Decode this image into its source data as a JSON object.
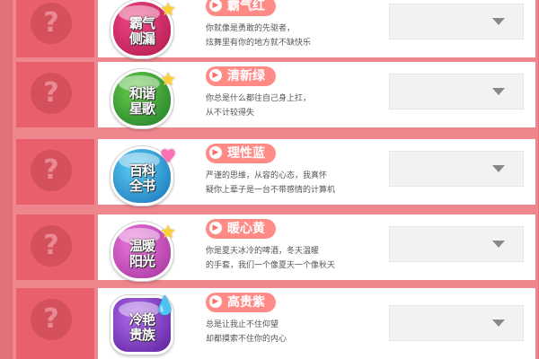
{
  "rows": [
    {
      "badge_text": [
        "霸气",
        "侧漏"
      ],
      "badge_color": "#c8265a",
      "badge_icon": "heart-star-icon",
      "title": "霸气红",
      "desc": [
        "你就像是勇敢的先驱者，",
        "炫舞里有你的地方就不缺快乐"
      ],
      "dropdown_value": ""
    },
    {
      "badge_text": [
        "和谐",
        "星歌"
      ],
      "badge_color": "#2f9a3a",
      "badge_icon": "star-icon",
      "title": "清新绿",
      "desc": [
        "你总是什么都往自己身上扛，",
        "从不计较得失"
      ],
      "dropdown_value": ""
    },
    {
      "badge_text": [
        "百科",
        "全书"
      ],
      "badge_color": "#1d8fd0",
      "badge_icon": "heart-icon",
      "title": "理性蓝",
      "desc": [
        "严谨的思维，从容的心态，我真怀",
        "疑你上辈子是一台不带感情的计算机"
      ],
      "dropdown_value": ""
    },
    {
      "badge_text": [
        "温暖",
        "阳光"
      ],
      "badge_color": "#d24fb6",
      "badge_icon": "star-icon",
      "title": "暖心黄",
      "desc": [
        "你是夏天冰冷的啤酒，冬天温暖",
        "的手套，我们一个像夏天一个像秋天"
      ],
      "dropdown_value": ""
    },
    {
      "badge_text": [
        "冷艳",
        "贵族"
      ],
      "badge_color": "#8a3fc4",
      "badge_icon": "drop-icon",
      "title": "高贵紫",
      "desc": [
        "总是让我止不住仰望",
        "却都摸索不住你的内心"
      ],
      "dropdown_value": ""
    }
  ],
  "colors": {
    "page_bg": "#e2707a",
    "frame": "#ef868e",
    "left_cell": "#e95f6c",
    "title_pill": "#ff8a86"
  },
  "icons": {
    "placeholder": "question-mark-icon",
    "dropdown": "chevron-down-icon",
    "title_bullet": "arrow-right-icon"
  }
}
